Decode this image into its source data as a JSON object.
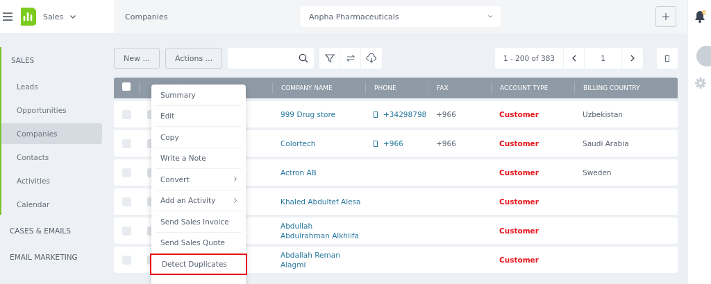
{
  "app": {
    "module": "Sales"
  },
  "breadcrumb": "Companies",
  "company_select": {
    "value": "Anpha Pharmaceuticals"
  },
  "sidebar": {
    "sections": [
      {
        "label": "SALES",
        "expanded": true,
        "children": [
          {
            "label": "Leads",
            "selected": false
          },
          {
            "label": "Opportunities",
            "selected": false
          },
          {
            "label": "Companies",
            "selected": true
          },
          {
            "label": "Contacts",
            "selected": false
          },
          {
            "label": "Activities",
            "selected": false
          },
          {
            "label": "Calendar",
            "selected": false
          }
        ]
      },
      {
        "label": "CASES & EMAILS",
        "expanded": false
      },
      {
        "label": "EMAIL MARKETING",
        "expanded": false
      }
    ]
  },
  "toolbar": {
    "buttons": [
      "New ...",
      "Actions ..."
    ],
    "pagination": {
      "range": "1 - 200 of 383",
      "page": "1"
    }
  },
  "table": {
    "select_all_checked": false,
    "columns": [
      "COMPANY NAME",
      "PHONE",
      "FAX",
      "ACCOUNT TYPE",
      "BILLING COUNTRY"
    ],
    "rows": [
      {
        "checked": false,
        "company": "999 Drug store",
        "phone": "+34298798",
        "fax": "+966",
        "account_type": "Customer",
        "country": "Uzbekistan"
      },
      {
        "checked": false,
        "company": "Colortech",
        "phone": "+966",
        "fax": "+966",
        "account_type": "Customer",
        "country": "Saudi Arabia"
      },
      {
        "checked": false,
        "company": "Actron AB",
        "phone": "",
        "fax": "",
        "account_type": "Customer",
        "country": "Sweden"
      },
      {
        "checked": false,
        "company": "Khaled Abdultef Alesa",
        "phone": "",
        "fax": "",
        "account_type": "Customer",
        "country": ""
      },
      {
        "checked": false,
        "company": "Abdullah\nAbdulrahman Alkhlifa",
        "phone": "",
        "fax": "",
        "account_type": "Customer",
        "country": ""
      },
      {
        "checked": false,
        "company": "Abdallah Reman\nAlagmi",
        "phone": "",
        "fax": "",
        "account_type": "Customer",
        "country": ""
      }
    ]
  },
  "context_menu": {
    "items": [
      {
        "label": "Summary",
        "submenu": false,
        "highlighted": false
      },
      {
        "label": "Edit",
        "submenu": false,
        "highlighted": false
      },
      {
        "label": "Copy",
        "submenu": false,
        "highlighted": false
      },
      {
        "label": "Write a Note",
        "submenu": false,
        "highlighted": false
      },
      {
        "label": "Convert",
        "submenu": true,
        "highlighted": false
      },
      {
        "label": "Add an Activity",
        "submenu": true,
        "highlighted": false
      },
      {
        "label": "Send Sales Invoice",
        "submenu": false,
        "highlighted": false
      },
      {
        "label": "Send Sales Quote",
        "submenu": false,
        "highlighted": false
      },
      {
        "label": "Detect Duplicates",
        "submenu": false,
        "highlighted": true
      }
    ]
  }
}
